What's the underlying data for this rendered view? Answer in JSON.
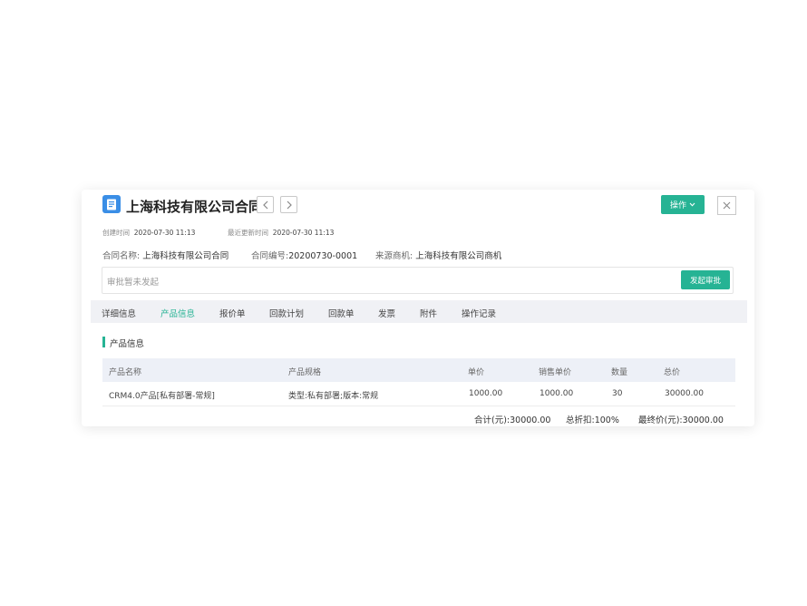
{
  "header": {
    "title": "上海科技有限公司合同",
    "icon": "document-icon",
    "action_label": "操作",
    "accent_color": "#26b394"
  },
  "meta": {
    "created_label": "创建时间",
    "created_value": "2020-07-30 11:13",
    "updated_label": "最近更新时间",
    "updated_value": "2020-07-30 11:13"
  },
  "info": {
    "name_label": "合同名称:",
    "name_value": "上海科技有限公司合同",
    "number_label": "合同编号:",
    "number_value": "20200730-0001",
    "source_label": "来源商机:",
    "source_value": "上海科技有限公司商机"
  },
  "approval": {
    "status_text": "审批暂未发起",
    "button_label": "发起审批"
  },
  "tabs": [
    {
      "label": "详细信息"
    },
    {
      "label": "产品信息",
      "active": true
    },
    {
      "label": "报价单"
    },
    {
      "label": "回款计划"
    },
    {
      "label": "回款单"
    },
    {
      "label": "发票"
    },
    {
      "label": "附件"
    },
    {
      "label": "操作记录"
    }
  ],
  "section": {
    "title": "产品信息"
  },
  "table": {
    "columns": [
      "产品名称",
      "产品规格",
      "单价",
      "销售单价",
      "数量",
      "总价"
    ],
    "rows": [
      [
        "CRM4.0产品[私有部署-常规]",
        "类型:私有部署;版本:常规",
        "1000.00",
        "1000.00",
        "30",
        "30000.00"
      ]
    ]
  },
  "summary": {
    "total_label": "合计(元):",
    "total_value": "30000.00",
    "discount_label": "总折扣:",
    "discount_value": "100%",
    "final_label": "最终价(元):",
    "final_value": "30000.00"
  }
}
